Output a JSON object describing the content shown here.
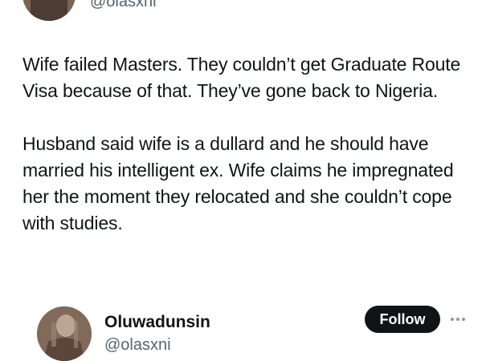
{
  "quoted_header": {
    "avatar_icon": "avatar-photo-icon",
    "handle": "@olasxni"
  },
  "tweet": {
    "paragraphs": [
      "Wife failed Masters. They couldn’t get Graduate Route Visa because of that. They’ve gone back to Nigeria.",
      "Husband said wife is a dullard and he should have married his intelligent ex. Wife claims he impregnated her the moment they relocated and she couldn’t cope with studies."
    ]
  },
  "author": {
    "avatar_icon": "avatar-photo-icon",
    "display_name": "Oluwadunsin",
    "handle": "@olasxni",
    "follow_label": "Follow",
    "more_icon": "more-horizontal-icon"
  },
  "colors": {
    "text_primary": "#0f1419",
    "text_secondary": "#536471",
    "button_bg": "#0f1419",
    "button_text": "#ffffff",
    "more_icon": "#8b98a5"
  }
}
